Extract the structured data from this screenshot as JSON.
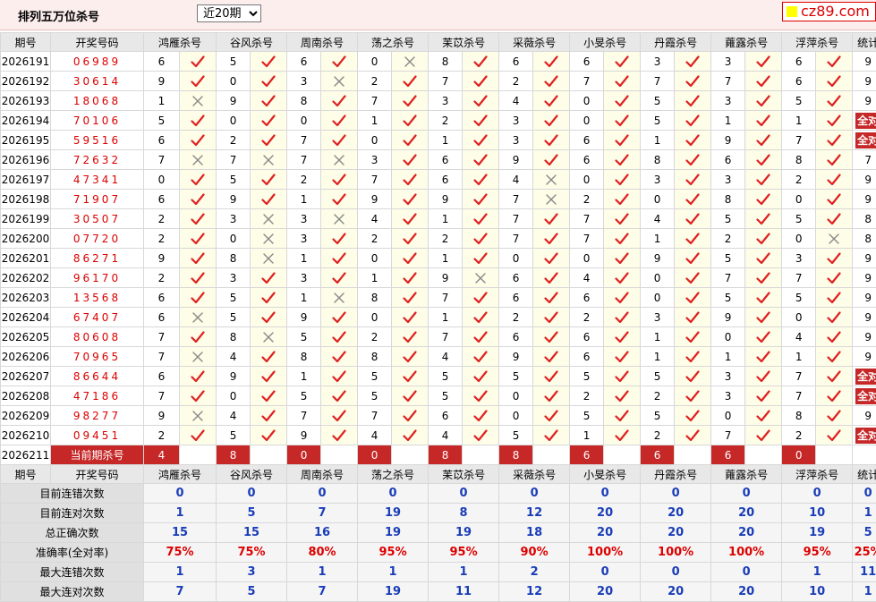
{
  "header": {
    "title": "排列五万位杀号",
    "select_value": "近20期",
    "logo_text": "cz89.com"
  },
  "columns": {
    "issue": "期号",
    "draw": "开奖号码",
    "experts": [
      "鸿雁杀号",
      "谷风杀号",
      "周南杀号",
      "荡之杀号",
      "苿苡杀号",
      "采薇杀号",
      "小旻杀号",
      "丹霞杀号",
      "蕹露杀号",
      "浮萍杀号"
    ],
    "stat": "统计"
  },
  "rows": [
    {
      "issue": "2026191",
      "draw": "06989",
      "kills": [
        6,
        5,
        6,
        0,
        8,
        6,
        6,
        3,
        3,
        6
      ],
      "ok": [
        1,
        1,
        1,
        0,
        1,
        1,
        1,
        1,
        1,
        1
      ],
      "stat": "9"
    },
    {
      "issue": "2026192",
      "draw": "30614",
      "kills": [
        9,
        0,
        3,
        2,
        7,
        2,
        7,
        7,
        7,
        6
      ],
      "ok": [
        1,
        1,
        0,
        1,
        1,
        1,
        1,
        1,
        1,
        1
      ],
      "stat": "9"
    },
    {
      "issue": "2026193",
      "draw": "18068",
      "kills": [
        1,
        9,
        8,
        7,
        3,
        4,
        0,
        5,
        3,
        5
      ],
      "ok": [
        0,
        1,
        1,
        1,
        1,
        1,
        1,
        1,
        1,
        1
      ],
      "stat": "9"
    },
    {
      "issue": "2026194",
      "draw": "70106",
      "kills": [
        5,
        0,
        0,
        1,
        2,
        3,
        0,
        5,
        1,
        1
      ],
      "ok": [
        1,
        1,
        1,
        1,
        1,
        1,
        1,
        1,
        1,
        1
      ],
      "stat": "全对"
    },
    {
      "issue": "2026195",
      "draw": "59516",
      "kills": [
        6,
        2,
        7,
        0,
        1,
        3,
        6,
        1,
        9,
        7
      ],
      "ok": [
        1,
        1,
        1,
        1,
        1,
        1,
        1,
        1,
        1,
        1
      ],
      "stat": "全对"
    },
    {
      "issue": "2026196",
      "draw": "72632",
      "kills": [
        7,
        7,
        7,
        3,
        6,
        9,
        6,
        8,
        6,
        8
      ],
      "ok": [
        0,
        0,
        0,
        1,
        1,
        1,
        1,
        1,
        1,
        1
      ],
      "stat": "7"
    },
    {
      "issue": "2026197",
      "draw": "47341",
      "kills": [
        0,
        5,
        2,
        7,
        6,
        4,
        0,
        3,
        3,
        2
      ],
      "ok": [
        1,
        1,
        1,
        1,
        1,
        0,
        1,
        1,
        1,
        1
      ],
      "stat": "9"
    },
    {
      "issue": "2026198",
      "draw": "71907",
      "kills": [
        6,
        9,
        1,
        9,
        9,
        7,
        2,
        0,
        8,
        0
      ],
      "ok": [
        1,
        1,
        1,
        1,
        1,
        0,
        1,
        1,
        1,
        1
      ],
      "stat": "9"
    },
    {
      "issue": "2026199",
      "draw": "30507",
      "kills": [
        2,
        3,
        3,
        4,
        1,
        7,
        7,
        4,
        5,
        5
      ],
      "ok": [
        1,
        0,
        0,
        1,
        1,
        1,
        1,
        1,
        1,
        1
      ],
      "stat": "8"
    },
    {
      "issue": "2026200",
      "draw": "07720",
      "kills": [
        2,
        0,
        3,
        2,
        2,
        7,
        7,
        1,
        2,
        0
      ],
      "ok": [
        1,
        0,
        1,
        1,
        1,
        1,
        1,
        1,
        1,
        0
      ],
      "stat": "8"
    },
    {
      "issue": "2026201",
      "draw": "86271",
      "kills": [
        9,
        8,
        1,
        0,
        1,
        0,
        0,
        9,
        5,
        3
      ],
      "ok": [
        1,
        0,
        1,
        1,
        1,
        1,
        1,
        1,
        1,
        1
      ],
      "stat": "9"
    },
    {
      "issue": "2026202",
      "draw": "96170",
      "kills": [
        2,
        3,
        3,
        1,
        9,
        6,
        4,
        0,
        7,
        7
      ],
      "ok": [
        1,
        1,
        1,
        1,
        0,
        1,
        1,
        1,
        1,
        1
      ],
      "stat": "9"
    },
    {
      "issue": "2026203",
      "draw": "13568",
      "kills": [
        6,
        5,
        1,
        8,
        7,
        6,
        6,
        0,
        5,
        5
      ],
      "ok": [
        1,
        1,
        0,
        1,
        1,
        1,
        1,
        1,
        1,
        1
      ],
      "stat": "9"
    },
    {
      "issue": "2026204",
      "draw": "67407",
      "kills": [
        6,
        5,
        9,
        0,
        1,
        2,
        2,
        3,
        9,
        0
      ],
      "ok": [
        0,
        1,
        1,
        1,
        1,
        1,
        1,
        1,
        1,
        1
      ],
      "stat": "9"
    },
    {
      "issue": "2026205",
      "draw": "80608",
      "kills": [
        7,
        8,
        5,
        2,
        7,
        6,
        6,
        1,
        0,
        4
      ],
      "ok": [
        1,
        0,
        1,
        1,
        1,
        1,
        1,
        1,
        1,
        1
      ],
      "stat": "9"
    },
    {
      "issue": "2026206",
      "draw": "70965",
      "kills": [
        7,
        4,
        8,
        8,
        4,
        9,
        6,
        1,
        1,
        1
      ],
      "ok": [
        0,
        1,
        1,
        1,
        1,
        1,
        1,
        1,
        1,
        1
      ],
      "stat": "9"
    },
    {
      "issue": "2026207",
      "draw": "86644",
      "kills": [
        6,
        9,
        1,
        5,
        5,
        5,
        5,
        5,
        3,
        7
      ],
      "ok": [
        1,
        1,
        1,
        1,
        1,
        1,
        1,
        1,
        1,
        1
      ],
      "stat": "全对"
    },
    {
      "issue": "2026208",
      "draw": "47186",
      "kills": [
        7,
        0,
        5,
        5,
        5,
        0,
        2,
        2,
        3,
        7
      ],
      "ok": [
        1,
        1,
        1,
        1,
        1,
        1,
        1,
        1,
        1,
        1
      ],
      "stat": "全对"
    },
    {
      "issue": "2026209",
      "draw": "98277",
      "kills": [
        9,
        4,
        7,
        7,
        6,
        0,
        5,
        5,
        0,
        8
      ],
      "ok": [
        0,
        1,
        1,
        1,
        1,
        1,
        1,
        1,
        1,
        1
      ],
      "stat": "9"
    },
    {
      "issue": "2026210",
      "draw": "09451",
      "kills": [
        2,
        5,
        9,
        4,
        4,
        5,
        1,
        2,
        7,
        2
      ],
      "ok": [
        1,
        1,
        1,
        1,
        1,
        1,
        1,
        1,
        1,
        1
      ],
      "stat": "全对"
    }
  ],
  "current": {
    "issue": "2026211",
    "label": "当前期杀号",
    "kills": [
      4,
      8,
      0,
      0,
      8,
      8,
      6,
      6,
      6,
      0
    ]
  },
  "stats": [
    {
      "label": "目前连错次数",
      "values": [
        "0",
        "0",
        "0",
        "0",
        "0",
        "0",
        "0",
        "0",
        "0",
        "0"
      ],
      "stat": "0",
      "pct": false
    },
    {
      "label": "目前连对次数",
      "values": [
        "1",
        "5",
        "7",
        "19",
        "8",
        "12",
        "20",
        "20",
        "20",
        "10"
      ],
      "stat": "1",
      "pct": false
    },
    {
      "label": "总正确次数",
      "values": [
        "15",
        "15",
        "16",
        "19",
        "19",
        "18",
        "20",
        "20",
        "20",
        "19"
      ],
      "stat": "5",
      "pct": false
    },
    {
      "label": "准确率(全对率)",
      "values": [
        "75%",
        "75%",
        "80%",
        "95%",
        "95%",
        "90%",
        "100%",
        "100%",
        "100%",
        "95%"
      ],
      "stat": "25%",
      "pct": true
    },
    {
      "label": "最大连错次数",
      "values": [
        "1",
        "3",
        "1",
        "1",
        "1",
        "2",
        "0",
        "0",
        "0",
        "1"
      ],
      "stat": "11",
      "pct": false
    },
    {
      "label": "最大连对次数",
      "values": [
        "7",
        "5",
        "7",
        "19",
        "11",
        "12",
        "20",
        "20",
        "20",
        "10"
      ],
      "stat": "1",
      "pct": false
    }
  ],
  "colors": {
    "accent": "#c62828",
    "tick": "#e02020",
    "cross": "#888888",
    "draw_digits": "#dd0000",
    "stat_blue": "#1a3db8"
  },
  "icons": {
    "correct": "check-icon",
    "wrong": "cross-icon"
  }
}
